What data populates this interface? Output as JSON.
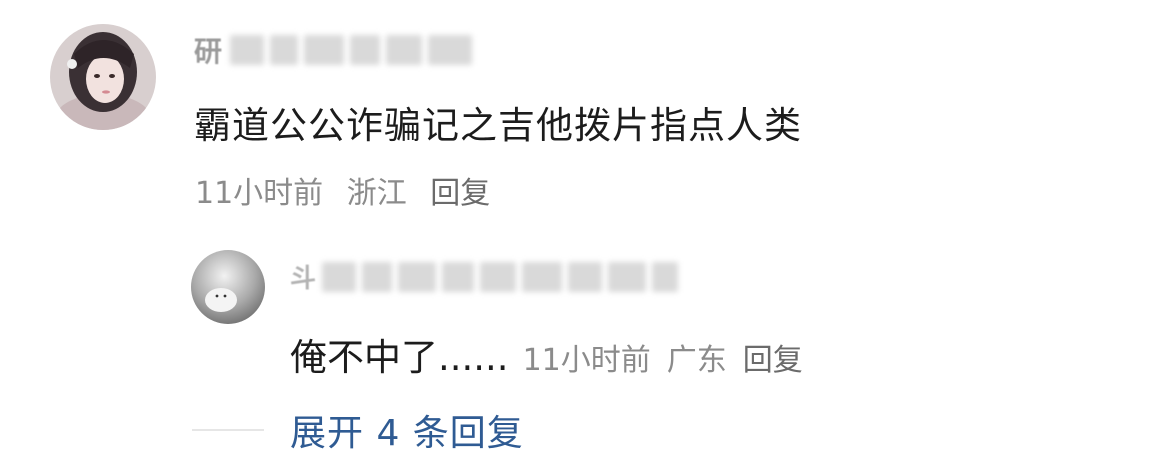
{
  "comment": {
    "username_visible_char": "研",
    "text": "霸道公公诈骗记之吉他拨片指点人类",
    "time": "11小时前",
    "location": "浙江",
    "reply_label": "回复"
  },
  "reply": {
    "username_visible_char": "斗",
    "text": "俺不中了......",
    "time": "11小时前",
    "location": "广东",
    "reply_label": "回复"
  },
  "expand": {
    "label": "展开 4 条回复"
  },
  "colors": {
    "text_primary": "#1c1c1c",
    "text_meta": "#8b8b8b",
    "link_blue": "#2f5b93"
  }
}
